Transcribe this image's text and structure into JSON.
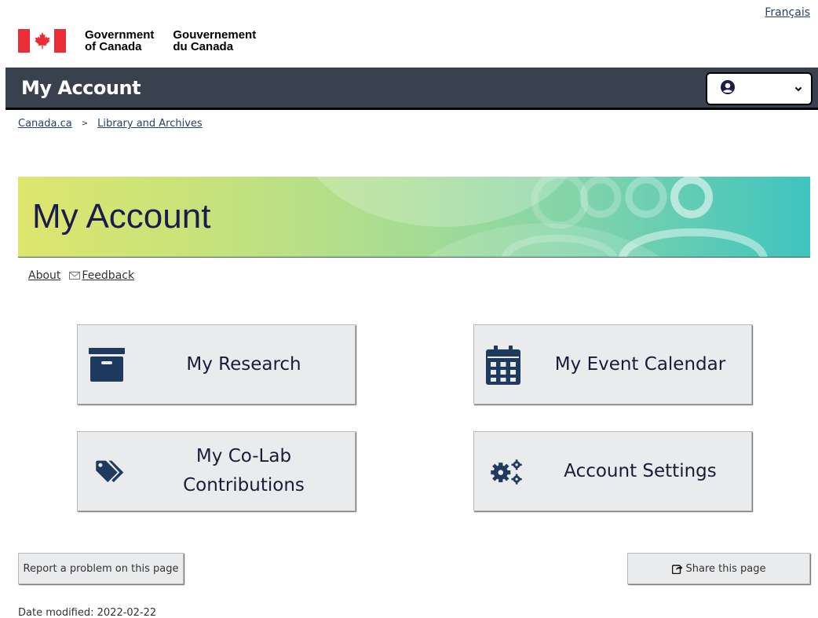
{
  "header": {
    "language_link": "Français",
    "gov_name_en_line1": "Government",
    "gov_name_en_line2": "of Canada",
    "gov_name_fr_line1": "Gouvernement",
    "gov_name_fr_line2": "du Canada"
  },
  "app_bar": {
    "title": "My Account",
    "account_menu_icon": "user-circle-icon",
    "account_menu_chevron": "chevron-down-icon"
  },
  "breadcrumb": {
    "items": [
      "Canada.ca",
      "Library and Archives"
    ],
    "separator": ">"
  },
  "banner": {
    "title": "My Account"
  },
  "utility_links": {
    "about": "About",
    "feedback": "Feedback"
  },
  "tiles": [
    {
      "label": "My Research",
      "icon": "archive-box-icon"
    },
    {
      "label": "My Event Calendar",
      "icon": "calendar-icon"
    },
    {
      "label_line1": "My Co-Lab",
      "label_line2": "Contributions",
      "icon": "tags-icon"
    },
    {
      "label": "Account Settings",
      "icon": "gears-icon"
    }
  ],
  "footer": {
    "report_problem": "Report a problem on this page",
    "share_page": "Share this page",
    "date_modified": "Date modified: 2022-02-22"
  },
  "colors": {
    "app_bar": "#38414d",
    "link": "#284162",
    "tile_bg": "#eaebed",
    "icon_navy": "#1f3a5f",
    "flag_red": "#eb2d37"
  }
}
